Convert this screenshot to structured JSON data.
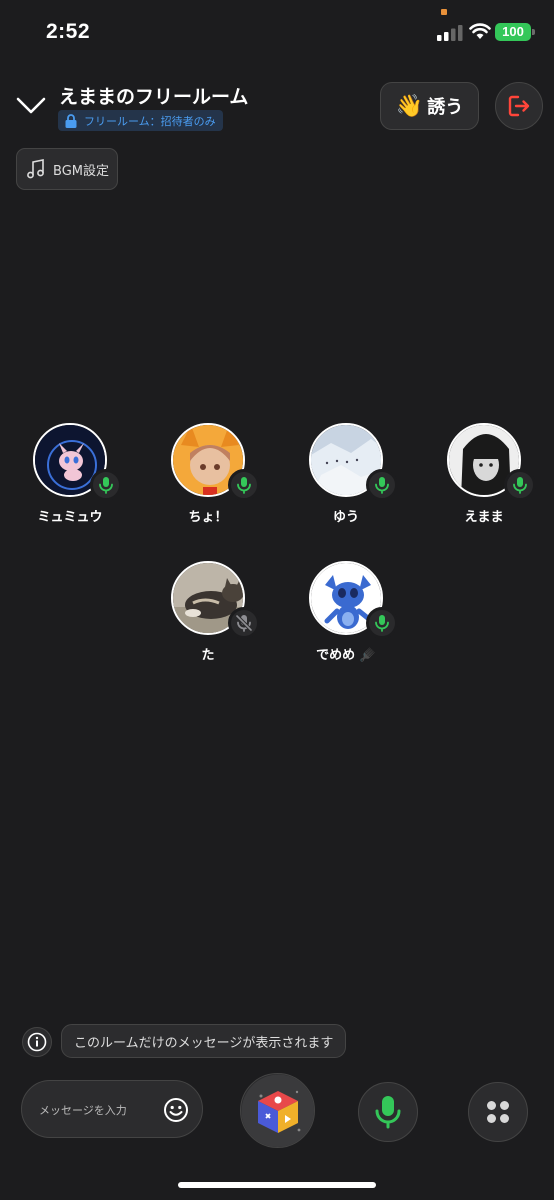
{
  "status_bar": {
    "time": "2:52",
    "battery": "100"
  },
  "header": {
    "room_title": "えままのフリールーム",
    "room_tag": "フリールーム：招待者のみ",
    "invite_label": "誘う",
    "invite_icon": "waving-hand-icon",
    "leave_icon": "exit-icon"
  },
  "bgm": {
    "label": "BGM設定",
    "icon": "music-note-icon"
  },
  "participants": [
    {
      "name": "ミュミュウ",
      "mic": "on"
    },
    {
      "name": "ちょ！",
      "mic": "on"
    },
    {
      "name": "ゆう",
      "mic": "on"
    },
    {
      "name": "えまま",
      "mic": "on"
    },
    {
      "name": "た",
      "mic": "muted"
    },
    {
      "name": "でめめ 🪮",
      "mic": "on"
    }
  ],
  "footer": {
    "info_message": "このルームだけのメッセージが表示されます",
    "message_placeholder": "メッセージを入力"
  },
  "colors": {
    "mic_on": "#34c759",
    "mic_muted": "#8e8e93",
    "accent_blue": "#4a9cf0",
    "leave_red": "#ff453a"
  }
}
